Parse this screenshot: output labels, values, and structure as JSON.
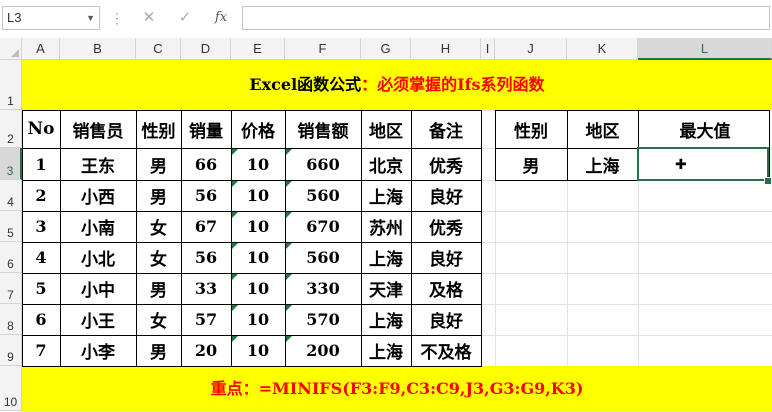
{
  "namebox": {
    "value": "L3",
    "dropdown": "▼"
  },
  "formula_bar": {
    "separator": "⋮",
    "cancel": "✕",
    "enter": "✓",
    "fx": "fx",
    "value": ""
  },
  "columns": [
    "A",
    "B",
    "C",
    "D",
    "E",
    "F",
    "G",
    "H",
    "I",
    "J",
    "K",
    "L"
  ],
  "rows": [
    "1",
    "2",
    "3",
    "4",
    "5",
    "6",
    "7",
    "8",
    "9",
    "10"
  ],
  "title": {
    "black": "Excel函数公式",
    "red": "：必须掌握的Ifs系列函数"
  },
  "headers": [
    "No",
    "销售员",
    "性别",
    "销量",
    "价格",
    "销售额",
    "地区",
    "备注"
  ],
  "data_rows": [
    [
      "1",
      "王东",
      "男",
      "66",
      "10",
      "660",
      "北京",
      "优秀"
    ],
    [
      "2",
      "小西",
      "男",
      "56",
      "10",
      "560",
      "上海",
      "良好"
    ],
    [
      "3",
      "小南",
      "女",
      "67",
      "10",
      "670",
      "苏州",
      "优秀"
    ],
    [
      "4",
      "小北",
      "女",
      "56",
      "10",
      "560",
      "上海",
      "良好"
    ],
    [
      "5",
      "小中",
      "男",
      "33",
      "10",
      "330",
      "天津",
      "及格"
    ],
    [
      "6",
      "小王",
      "女",
      "57",
      "10",
      "570",
      "上海",
      "良好"
    ],
    [
      "7",
      "小李",
      "男",
      "20",
      "10",
      "200",
      "上海",
      "不及格"
    ]
  ],
  "criteria": {
    "headers": [
      "性别",
      "地区",
      "最大值"
    ],
    "values": [
      "男",
      "上海",
      ""
    ]
  },
  "footer": {
    "black": "重点：",
    "red": "=MINIFS(F3:F9,C3:C9,J3,G3:G9,K3)"
  },
  "colors": {
    "highlight": "#ffff00",
    "accent_red": "#ff0000",
    "selection": "#217346"
  }
}
